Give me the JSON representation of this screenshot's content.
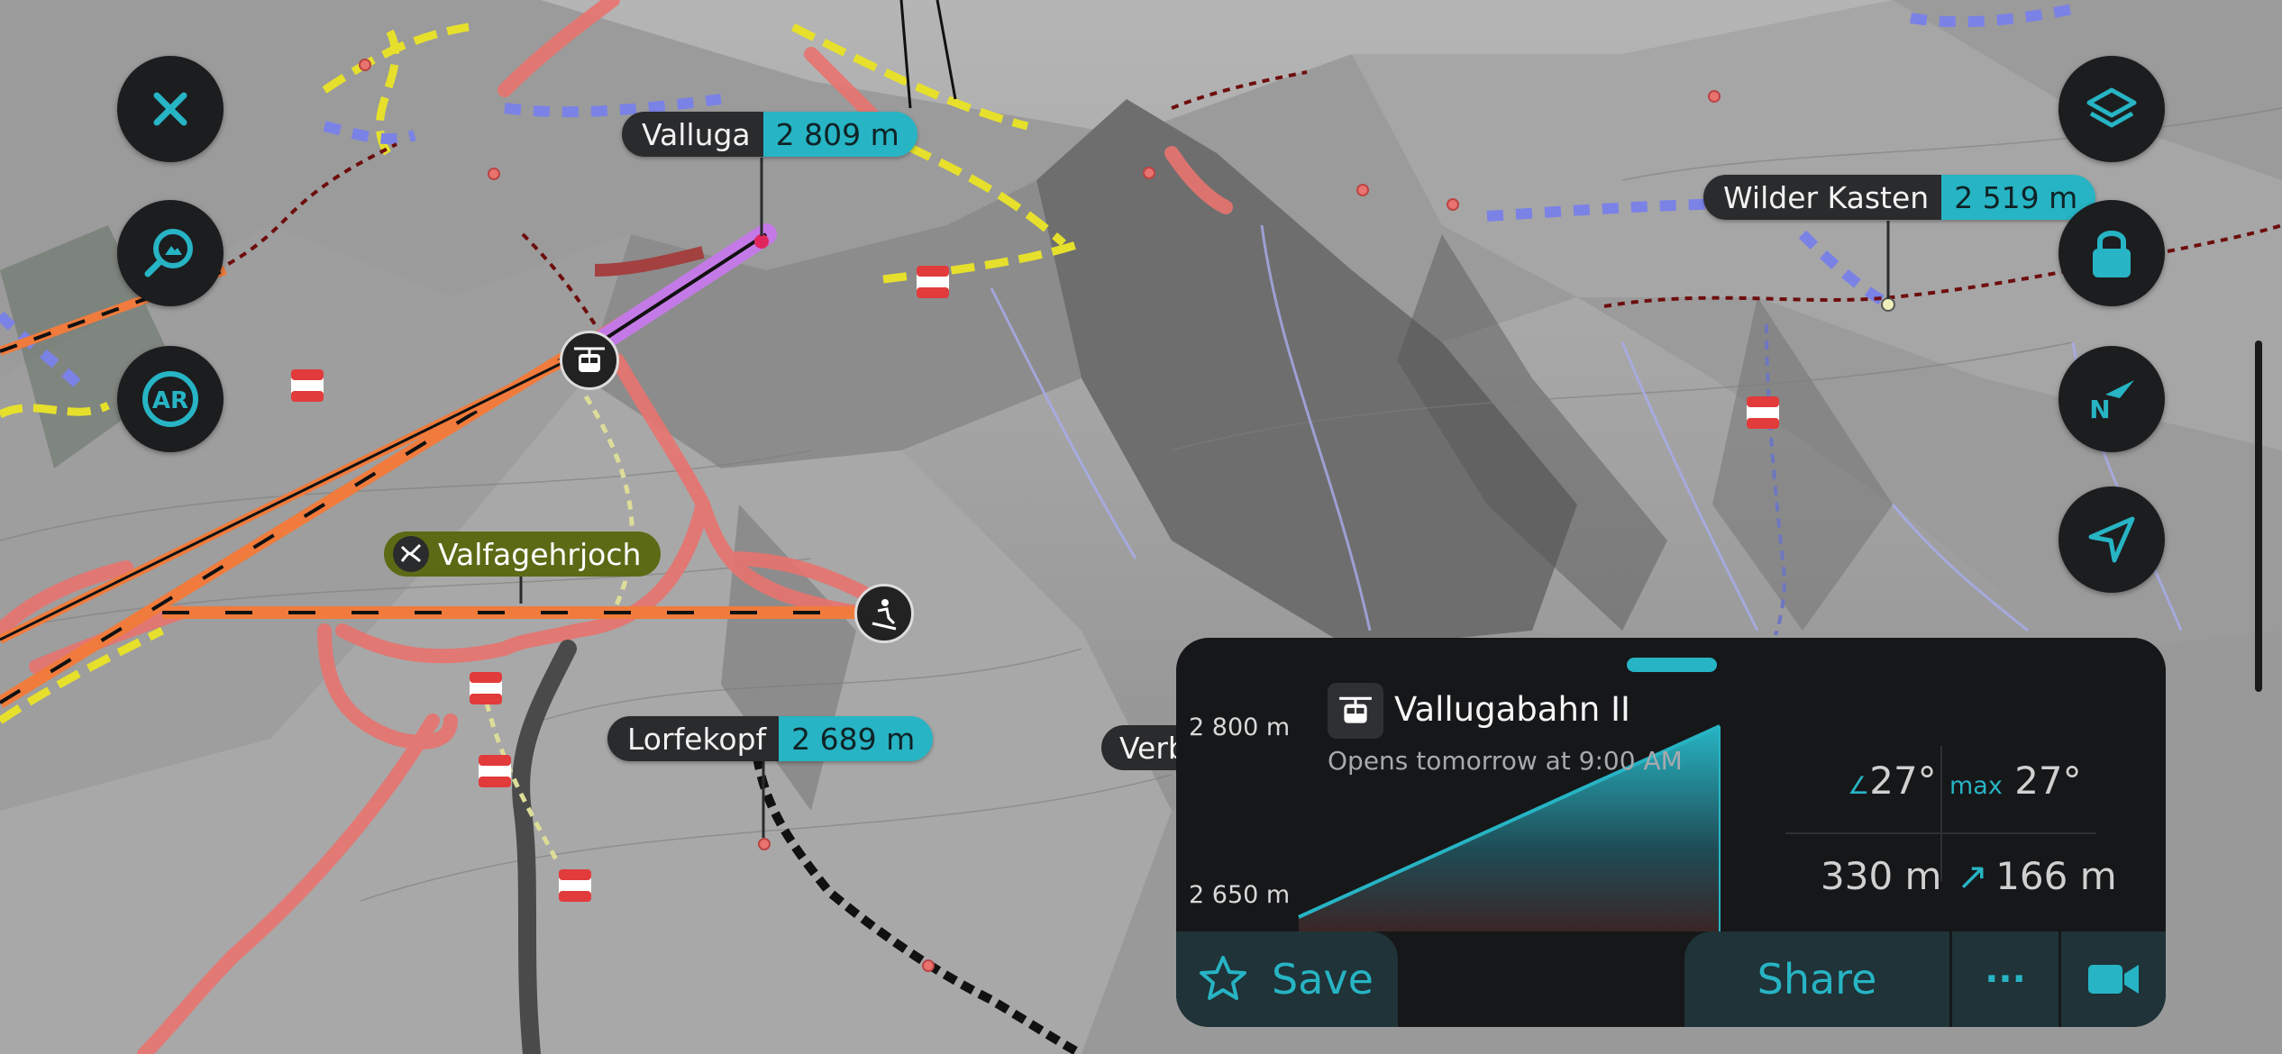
{
  "left_controls": {
    "close_icon": "close-icon",
    "search_icon": "peak-search-icon",
    "ar_label": "AR"
  },
  "right_controls": {
    "layers_icon": "layers-icon",
    "lock_icon": "lock-icon",
    "compass_label": "N",
    "location_icon": "location-arrow-icon"
  },
  "map_labels": {
    "valluga": {
      "name": "Valluga",
      "elevation": "2 809 m"
    },
    "wilder_kasten": {
      "name": "Wilder Kasten",
      "elevation": "2 519 m"
    },
    "lorfekopf": {
      "name": "Lorfekopf",
      "elevation": "2 689 m"
    },
    "valfagehrjoch": {
      "name": "Valfagehrjoch"
    },
    "partial_label": "Verb"
  },
  "panel": {
    "title": "Vallugabahn II",
    "subtitle": "Opens tomorrow at 9:00 AM",
    "axis_top": "2 800 m",
    "axis_bottom": "2 650 m",
    "slope_avg": "27°",
    "slope_max_label": "max",
    "slope_max": "27°",
    "length": "330 m",
    "ascent": "166 m",
    "save_label": "Save",
    "share_label": "Share",
    "more_label": "···"
  },
  "colors": {
    "accent": "#27b4c4",
    "panel_bg": "#161719",
    "button_bg": "#1f3338",
    "control_bg": "#1c1d1f",
    "piste_red": "#e8736f",
    "piste_yellow": "#e6e02c",
    "piste_blue": "#7b82e6",
    "lift_orange": "#f07b3c"
  }
}
